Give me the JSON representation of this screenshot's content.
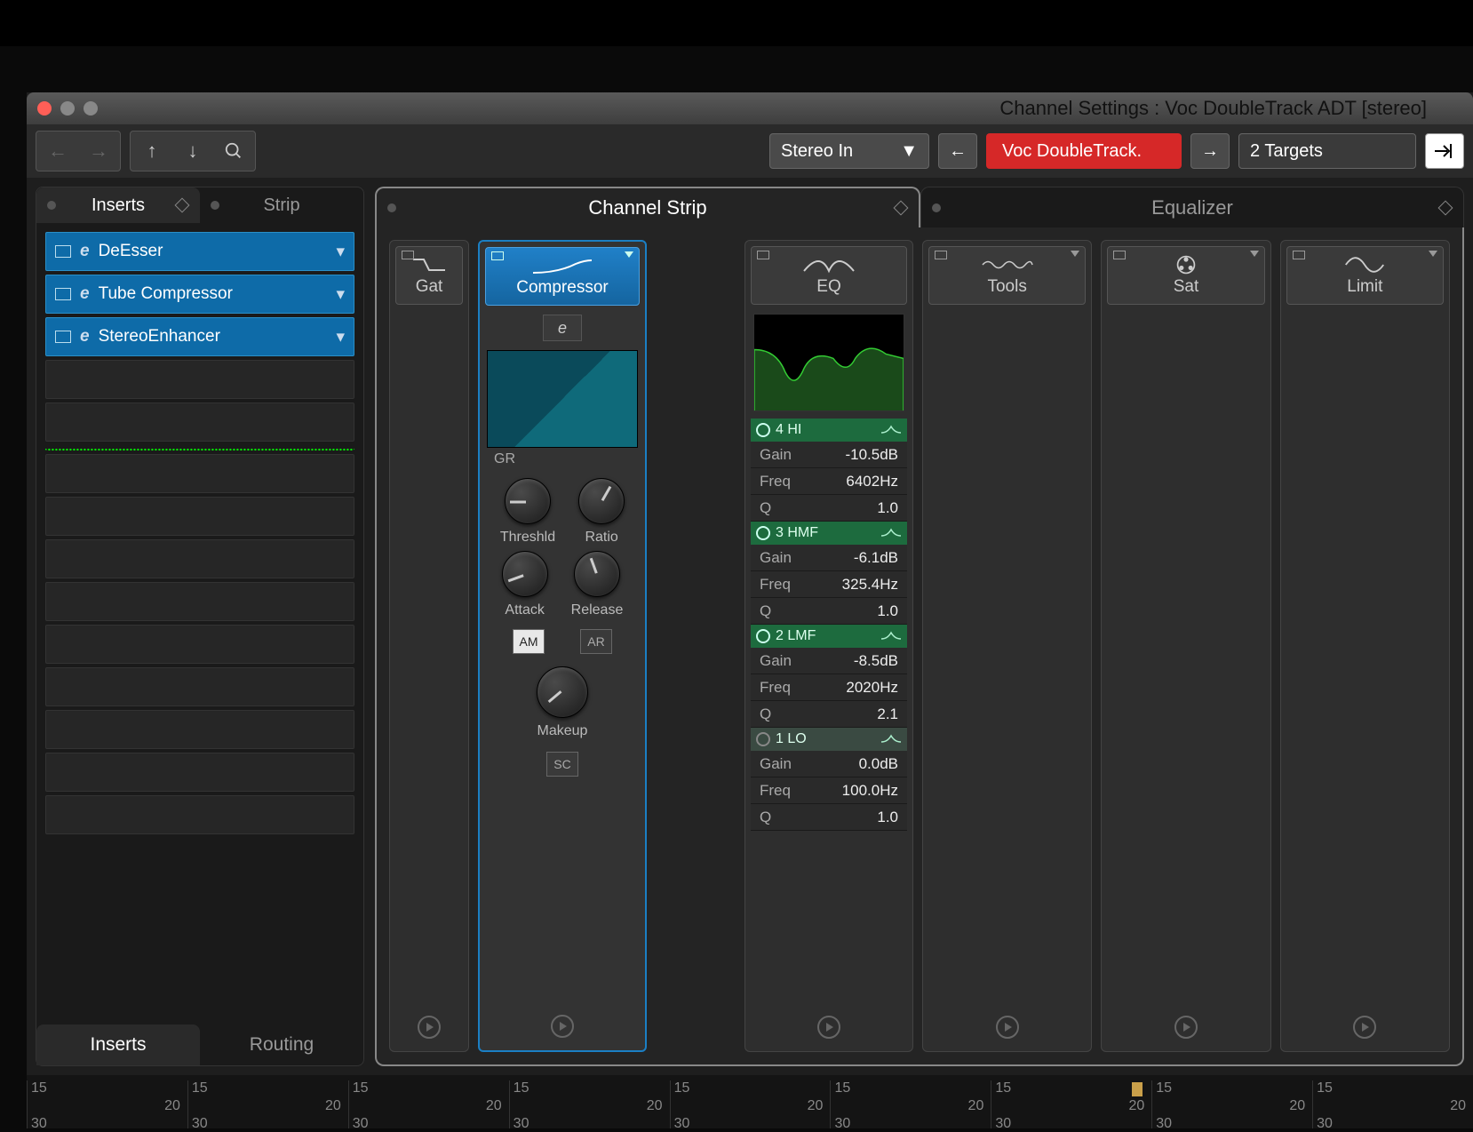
{
  "window": {
    "title": "Channel Settings : Voc DoubleTrack ADT [stereo]"
  },
  "toolbar": {
    "input_label": "Stereo In",
    "track_name": "Voc DoubleTrack.",
    "targets_label": "2 Targets"
  },
  "inserts_panel": {
    "tab_inserts": "Inserts",
    "tab_strip": "Strip",
    "slots": [
      {
        "name": "DeEsser"
      },
      {
        "name": "Tube Compressor"
      },
      {
        "name": "StereoEnhancer"
      }
    ],
    "bottom_tab_inserts": "Inserts",
    "bottom_tab_routing": "Routing"
  },
  "strip": {
    "tab_channel_strip": "Channel Strip",
    "tab_equalizer": "Equalizer",
    "modules": {
      "gate": "Gat",
      "compressor": "Compressor",
      "eq": "EQ",
      "tools": "Tools",
      "sat": "Sat",
      "limit": "Limit"
    },
    "compressor": {
      "gr_label": "GR",
      "e_button": "e",
      "knobs": {
        "threshold": "Threshld",
        "ratio": "Ratio",
        "attack": "Attack",
        "release": "Release",
        "makeup": "Makeup"
      },
      "toggles": {
        "am": "AM",
        "ar": "AR",
        "sc": "SC"
      }
    },
    "eq": {
      "bands": [
        {
          "id": "4",
          "name": "4 HI",
          "active": true,
          "gain": "-10.5dB",
          "freq": "6402Hz",
          "q": "1.0"
        },
        {
          "id": "3",
          "name": "3 HMF",
          "active": true,
          "gain": "-6.1dB",
          "freq": "325.4Hz",
          "q": "1.0"
        },
        {
          "id": "2",
          "name": "2 LMF",
          "active": true,
          "gain": "-8.5dB",
          "freq": "2020Hz",
          "q": "2.1"
        },
        {
          "id": "1",
          "name": "1 LO",
          "active": false,
          "gain": "0.0dB",
          "freq": "100.0Hz",
          "q": "1.0"
        }
      ],
      "labels": {
        "gain": "Gain",
        "freq": "Freq",
        "q": "Q"
      }
    }
  },
  "ruler": {
    "ticks": [
      "15",
      "20",
      "30"
    ]
  }
}
